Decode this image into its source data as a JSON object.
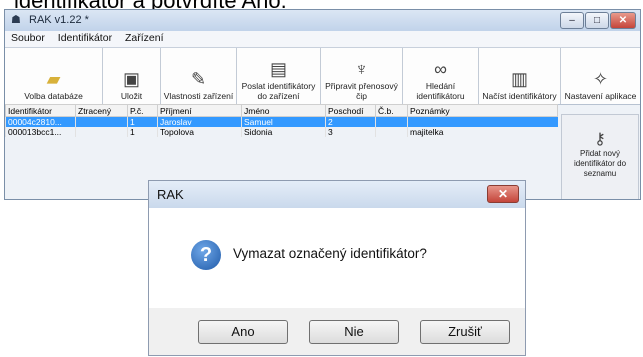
{
  "document": {
    "heading": "identifikátor a potvrdíte Ano."
  },
  "window": {
    "title": "RAK v1.22 *",
    "controls": {
      "minimize": "–",
      "maximize": "□",
      "close": "✕"
    }
  },
  "menu": [
    "Soubor",
    "Identifikátor",
    "Zařízení"
  ],
  "toolbar": [
    {
      "label": "Volba databáze",
      "icon": "folder-icon"
    },
    {
      "label": "Uložit",
      "icon": "save-icon"
    },
    {
      "label": "Vlastnosti zařízení",
      "icon": "device-properties-icon"
    },
    {
      "label": "Poslat identifikátory do zařízení",
      "icon": "send-icon"
    },
    {
      "label": "Připravit přenosový čip",
      "icon": "chip-icon"
    },
    {
      "label": "Hledání identifikátoru",
      "icon": "binoculars-icon"
    },
    {
      "label": "Načíst identifikátory",
      "icon": "load-icon"
    },
    {
      "label": "Nastavení aplikace",
      "icon": "wrench-icon"
    }
  ],
  "table": {
    "columns": [
      "Identifikátor",
      "Ztracený",
      "P.č.",
      "Příjmení",
      "Jméno",
      "Poschodí",
      "Č.b.",
      "Poznámky"
    ],
    "rows": [
      {
        "selected": true,
        "cells": [
          "00004c2810...",
          "",
          "1",
          "Jaroslav",
          "Samuel",
          "2",
          "",
          ""
        ]
      },
      {
        "selected": false,
        "cells": [
          "000013bcc1...",
          "",
          "1",
          "Topolova",
          "Sidonia",
          "3",
          "",
          "majitelka"
        ]
      }
    ]
  },
  "side_panel": {
    "label": "Přidat nový identifikátor do seznamu",
    "icon": "key-icon"
  },
  "dialog": {
    "title": "RAK",
    "close": "✕",
    "icon": "question-icon",
    "message": "Vymazat označený identifikátor?",
    "buttons": [
      "Ano",
      "Nie",
      "Zrušiť"
    ]
  },
  "colors": {
    "selection": "#3399ff",
    "close_button": "#c5453a"
  }
}
